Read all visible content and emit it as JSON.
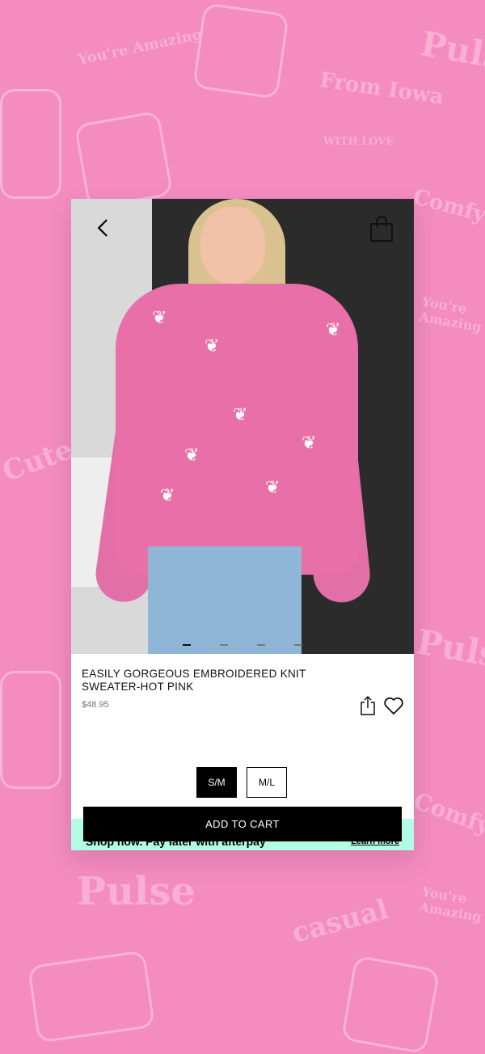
{
  "background": {
    "color": "#f48cbf",
    "decor_color": "#f9b3d6"
  },
  "background_decor": [
    "You're Amazing",
    "From Iowa",
    "WITH LOVE",
    "Comfy",
    "You're Amazing",
    "Cute",
    "Pulse",
    "Pulse",
    "Pulse",
    "casual",
    "You're Amazing",
    "Comfy"
  ],
  "product": {
    "title": "EASILY GORGEOUS EMBROIDERED KNIT SWEATER-HOT PINK",
    "price": "$48.95",
    "image_count": 4,
    "active_image": 1
  },
  "sizes": [
    {
      "label": "S/M",
      "selected": true
    },
    {
      "label": "M/L",
      "selected": false
    }
  ],
  "actions": {
    "add_to_cart": "ADD TO CART"
  },
  "afterpay": {
    "text": "Shop now. Pay later with afterpay",
    "link": "Learn more",
    "color": "#b2fce4"
  },
  "icons": {
    "back": "chevron-left-icon",
    "bag": "shopping-bag-icon",
    "share": "share-icon",
    "favorite": "heart-icon"
  }
}
